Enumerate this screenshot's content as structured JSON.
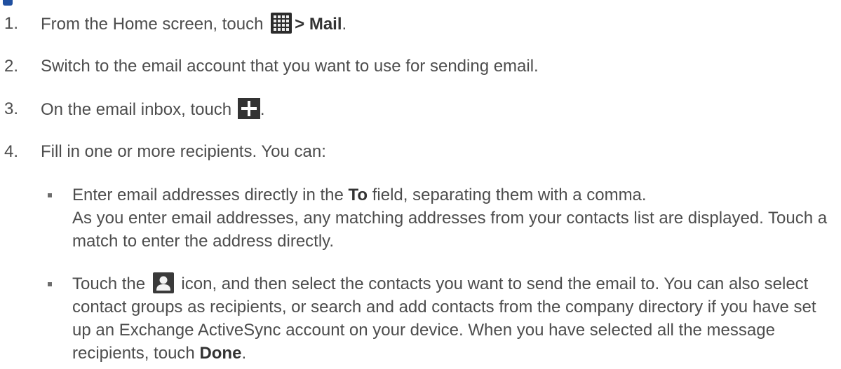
{
  "steps": [
    {
      "num": "1.",
      "pre": "From the Home screen, touch",
      "bold": "> Mail",
      "post": "."
    },
    {
      "num": "2.",
      "text": "Switch to the email account that you want to use for sending email."
    },
    {
      "num": "3.",
      "pre": "On the email inbox, touch",
      "post": "."
    },
    {
      "num": "4.",
      "text": "Fill in one or more recipients. You can:"
    }
  ],
  "bullets": [
    {
      "pre": "Enter email addresses directly in the ",
      "bold": "To",
      "post": " field, separating them with a comma.",
      "line2": "As you enter email addresses, any matching addresses from your contacts list are displayed. Touch a match to enter the address directly."
    },
    {
      "pre": "Touch the",
      "post": "icon, and then select the contacts you want to send the email to. You can also select contact groups as recipients, or search and add contacts from the company directory if you have set up an Exchange ActiveSync account on your device. When you have selected all the message recipients, touch ",
      "bold": "Done",
      "end": "."
    }
  ],
  "icons": {
    "step1": "app-grid-icon",
    "step3": "compose-plus-icon",
    "bullet2": "contacts-person-icon"
  }
}
